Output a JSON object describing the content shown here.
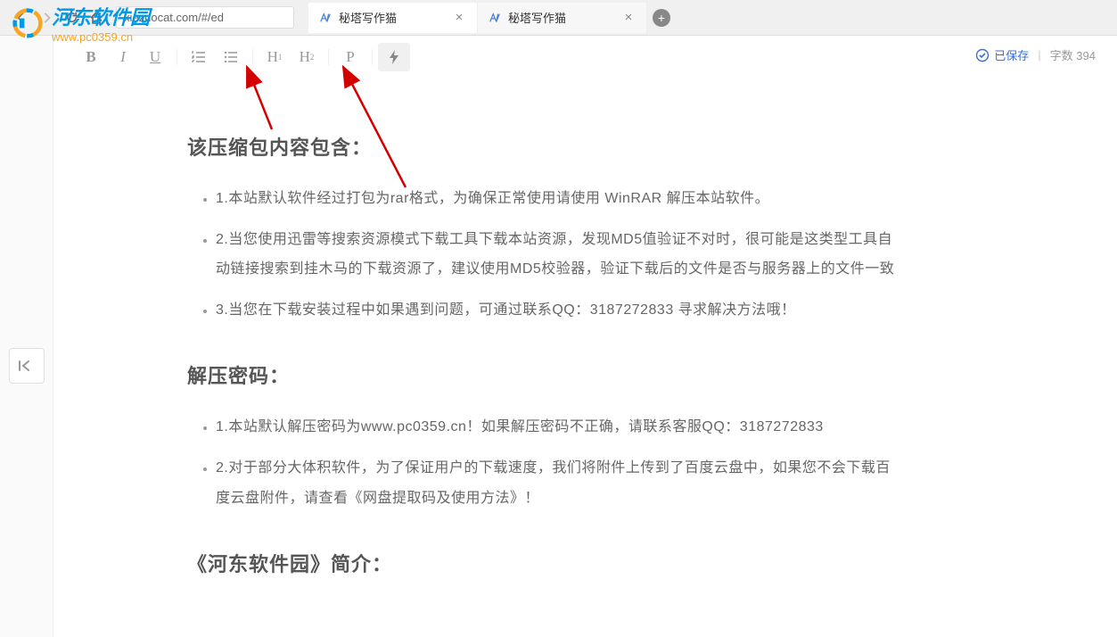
{
  "browser": {
    "url": "xiezuocat.com/#/ed",
    "tabs": [
      {
        "title": "秘塔写作猫",
        "active": true
      },
      {
        "title": "秘塔写作猫",
        "active": false
      }
    ]
  },
  "toolbar": {
    "bold": "B",
    "italic": "I",
    "underline": "U",
    "ol_icon": "ol",
    "ul_icon": "ul",
    "h1": "H",
    "h1_sub": "1",
    "h2": "H",
    "h2_sub": "2",
    "para": "P",
    "bolt": "bolt"
  },
  "status": {
    "saved_label": "已保存",
    "word_count_label": "字数",
    "word_count_value": "394"
  },
  "document": {
    "sections": [
      {
        "heading": "该压缩包内容包含：",
        "items": [
          "1.本站默认软件经过打包为rar格式，为确保正常使用请使用 WinRAR 解压本站软件。",
          "2.当您使用迅雷等搜索资源模式下载工具下载本站资源，发现MD5值验证不对时，很可能是这类型工具自动链接搜索到挂木马的下载资源了，建议使用MD5校验器，验证下载后的文件是否与服务器上的文件一致",
          "3.当您在下载安装过程中如果遇到问题，可通过联系QQ：3187272833 寻求解决方法哦！"
        ]
      },
      {
        "heading": "解压密码：",
        "items": [
          "1.本站默认解压密码为www.pc0359.cn！如果解压密码不正确，请联系客服QQ：3187272833",
          "2.对于部分大体积软件，为了保证用户的下载速度，我们将附件上传到了百度云盘中，如果您不会下载百度云盘附件，请查看《网盘提取码及使用方法》！"
        ]
      },
      {
        "heading": "《河东软件园》简介：",
        "items": []
      }
    ]
  },
  "watermark": {
    "name": "河东软件园",
    "url": "www.pc0359.cn"
  }
}
